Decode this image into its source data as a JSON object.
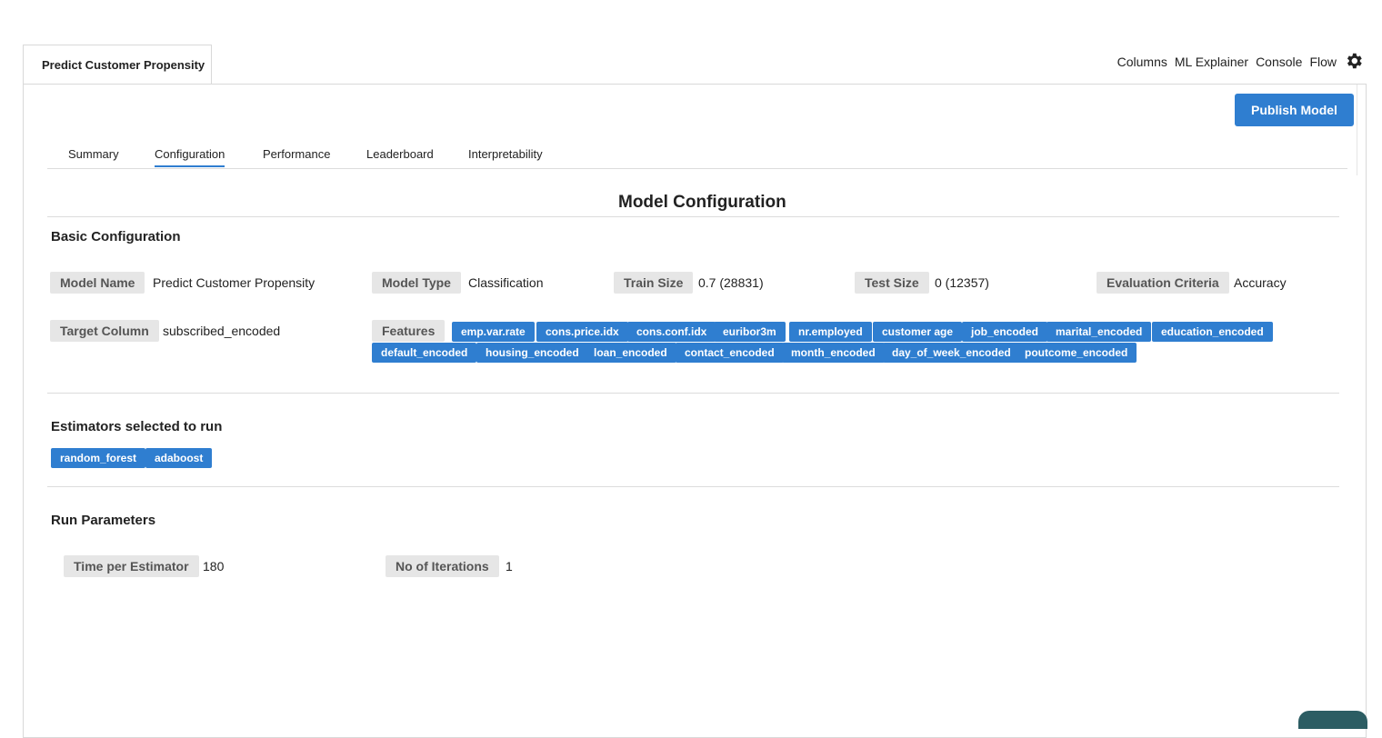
{
  "page_tab": "Predict Customer Propensity",
  "top_links": [
    "Columns",
    "ML Explainer",
    "Console",
    "Flow"
  ],
  "publish_button": "Publish Model",
  "subtabs": [
    "Summary",
    "Configuration",
    "Performance",
    "Leaderboard",
    "Interpretability"
  ],
  "active_subtab": "Configuration",
  "section_title": "Model Configuration",
  "basic": {
    "heading": "Basic Configuration",
    "model_name_label": "Model Name",
    "model_name": "Predict Customer Propensity",
    "model_type_label": "Model Type",
    "model_type": "Classification",
    "train_size_label": "Train Size",
    "train_size": "0.7 (28831)",
    "test_size_label": "Test Size",
    "test_size": "0 (12357)",
    "eval_label": "Evaluation Criteria",
    "eval": "Accuracy",
    "target_label": "Target Column",
    "target": "subscribed_encoded",
    "features_label": "Features",
    "features": [
      "emp.var.rate",
      "cons.price.idx",
      "cons.conf.idx",
      "euribor3m",
      "nr.employed",
      "customer age",
      "job_encoded",
      "marital_encoded",
      "education_encoded",
      "default_encoded",
      "housing_encoded",
      "loan_encoded",
      "contact_encoded",
      "month_encoded",
      "day_of_week_encoded",
      "poutcome_encoded"
    ]
  },
  "estimators": {
    "heading": "Estimators selected to run",
    "items": [
      "random_forest",
      "adaboost"
    ]
  },
  "run_params": {
    "heading": "Run Parameters",
    "time_label": "Time per Estimator",
    "time": "180",
    "iter_label": "No of Iterations",
    "iter": "1"
  },
  "accent_color": "#2f7ed0"
}
